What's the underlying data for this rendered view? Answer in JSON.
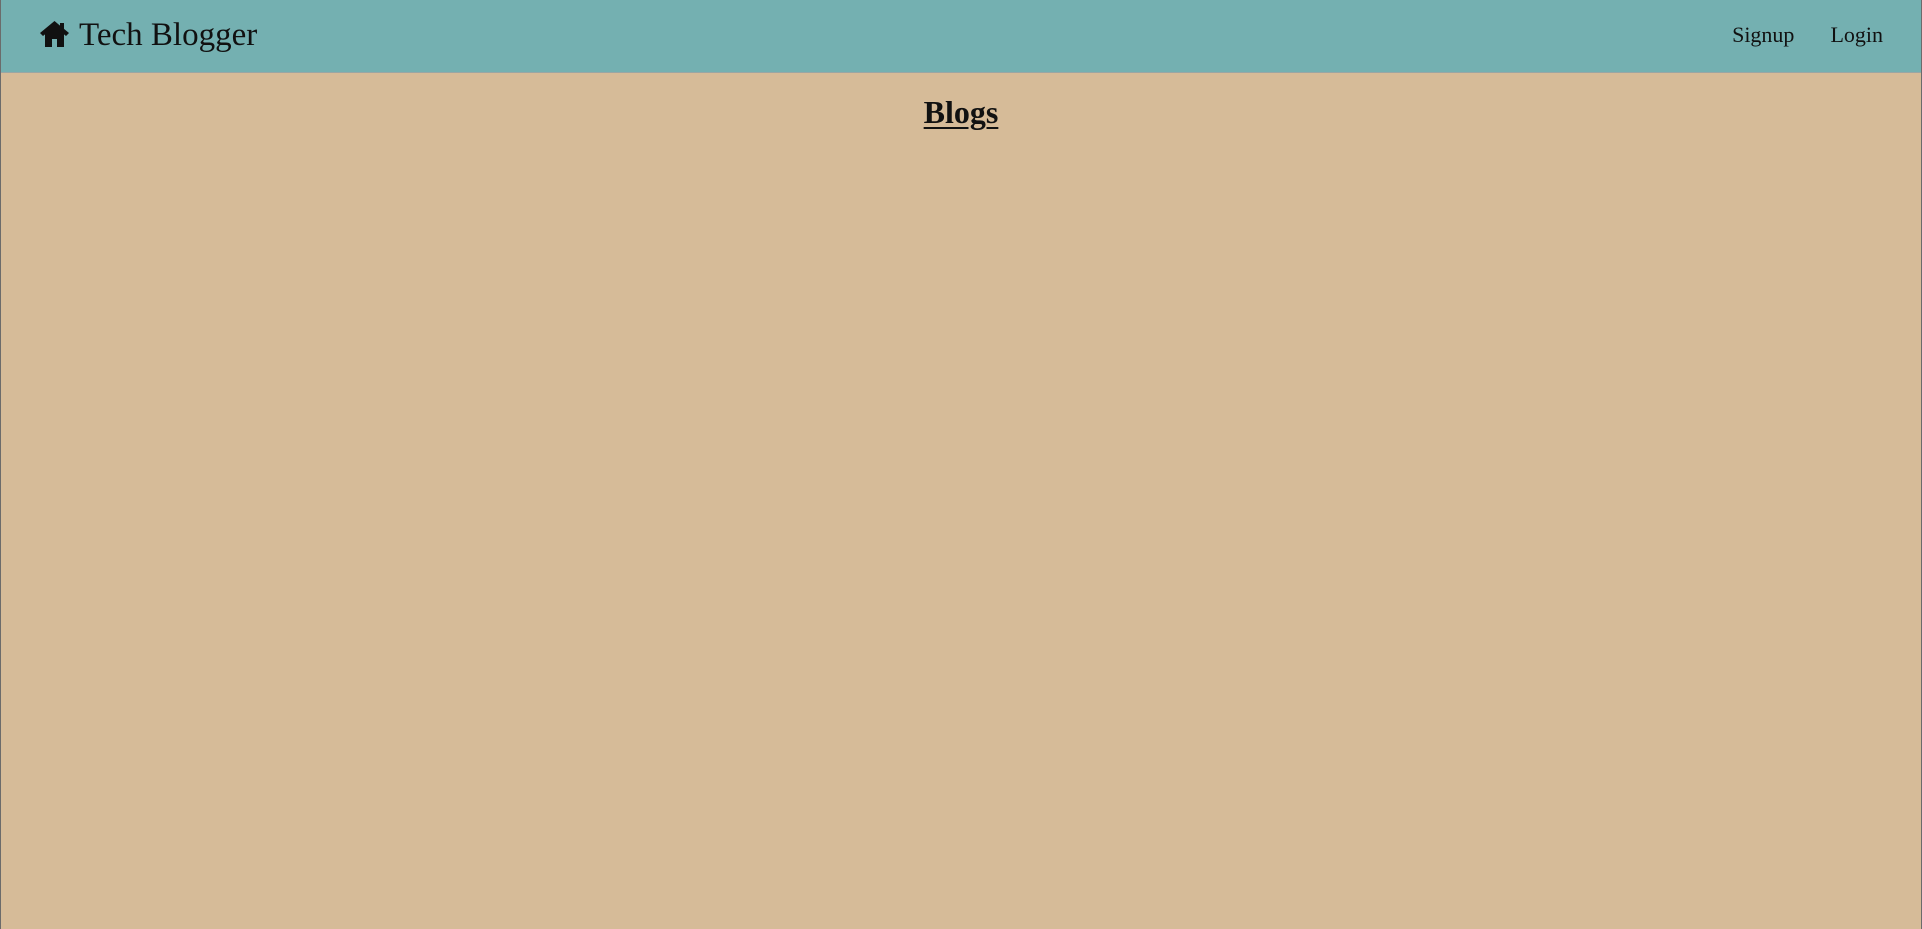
{
  "navbar": {
    "brand": {
      "icon": "home-icon",
      "title": "Tech Blogger"
    },
    "links": {
      "signup": "Signup",
      "login": "Login"
    }
  },
  "main": {
    "title": "Blogs",
    "blogs": []
  },
  "colors": {
    "navbar_background": "#74b0b1",
    "page_background": "#d6bb98",
    "text": "#111111"
  }
}
